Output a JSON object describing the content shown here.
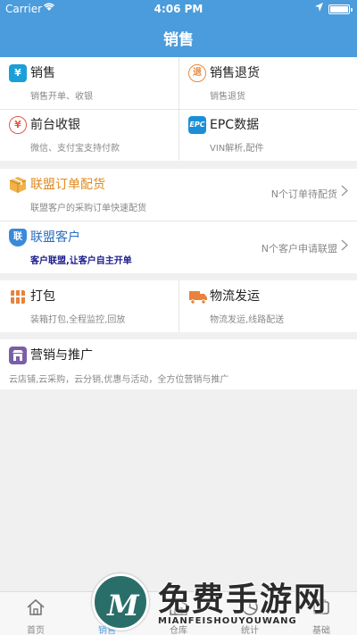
{
  "status_bar": {
    "carrier": "Carrier",
    "time": "4:06 PM"
  },
  "nav": {
    "title": "销售"
  },
  "section1": {
    "sales": {
      "icon": "¥",
      "title": "销售",
      "desc": "销售开单、收银",
      "color": "#1a9fd8"
    },
    "returns": {
      "icon": "退",
      "title": "销售退货",
      "desc": "销售退货",
      "color": "#e88a3c"
    },
    "pos": {
      "icon": "¥",
      "title": "前台收银",
      "desc": "微信、支付宝支持付款",
      "color": "#e05a4a"
    },
    "epc": {
      "icon": "EPC",
      "title": "EPC数据",
      "desc": "VIN解析,配件",
      "color": "#1a8fd8"
    }
  },
  "section2": {
    "alliance_order": {
      "title": "联盟订单配货",
      "desc": "联盟客户的采购订单快速配货",
      "note": "N个订单待配货",
      "color": "#e8a13c"
    },
    "alliance_customer": {
      "icon": "联",
      "title": "联盟客户",
      "desc": "客户联盟,让客户自主开单",
      "note": "N个客户申请联盟",
      "color": "#3a8ad8"
    }
  },
  "section3": {
    "pack": {
      "title": "打包",
      "desc": "装箱打包,全程监控,回放",
      "color": "#e8823c"
    },
    "logistics": {
      "title": "物流发运",
      "desc": "物流发运,线路配送",
      "color": "#e8823c"
    }
  },
  "section4": {
    "marketing": {
      "title": "营销与推广",
      "desc": "云店铺,云采购，云分销,优惠与活动，全方位营销与推广",
      "color": "#7a5ea8"
    }
  },
  "tabbar": {
    "tabs": [
      {
        "label": "首页",
        "icon": "home-icon"
      },
      {
        "label": "销售",
        "icon": "sales-icon"
      },
      {
        "label": "仓库",
        "icon": "warehouse-icon"
      },
      {
        "label": "统计",
        "icon": "stats-icon"
      },
      {
        "label": "基础",
        "icon": "basic-icon"
      }
    ]
  },
  "watermark": {
    "main": "免费手游网",
    "sub": "MIANFEISHOUYOUWANG",
    "logo": "M"
  }
}
